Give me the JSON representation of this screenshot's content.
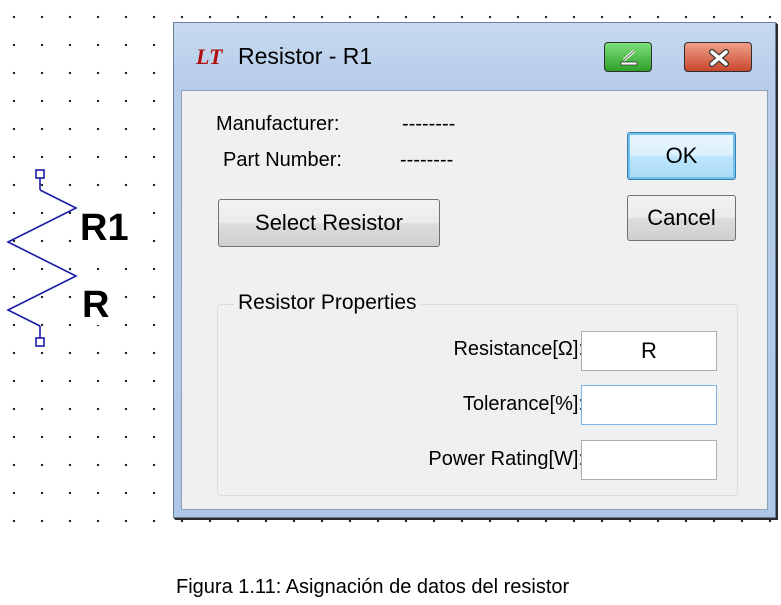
{
  "schematic": {
    "ref_label": "R1",
    "value_label": "R"
  },
  "dialog": {
    "title": "Resistor - R1",
    "app_icon_text": "LT",
    "manufacturer_label": "Manufacturer:",
    "manufacturer_value": "--------",
    "part_number_label": "Part Number:",
    "part_number_value": "--------",
    "select_button": "Select Resistor",
    "ok_button": "OK",
    "cancel_button": "Cancel",
    "group_title": "Resistor Properties",
    "properties": [
      {
        "label": "Resistance[Ω]:",
        "value": ""
      },
      {
        "label": "Tolerance[%]:",
        "value": ""
      },
      {
        "label": "Power Rating[W]:",
        "value": ""
      }
    ],
    "resistance_value": "R"
  },
  "caption": "Figura 1.11: Asignación de datos del resistor",
  "colors": {
    "wire": "#1a1aa8",
    "title_bg": "#b7cde9",
    "minimize_green": "#2ea02a",
    "close_red": "#c8472d"
  }
}
